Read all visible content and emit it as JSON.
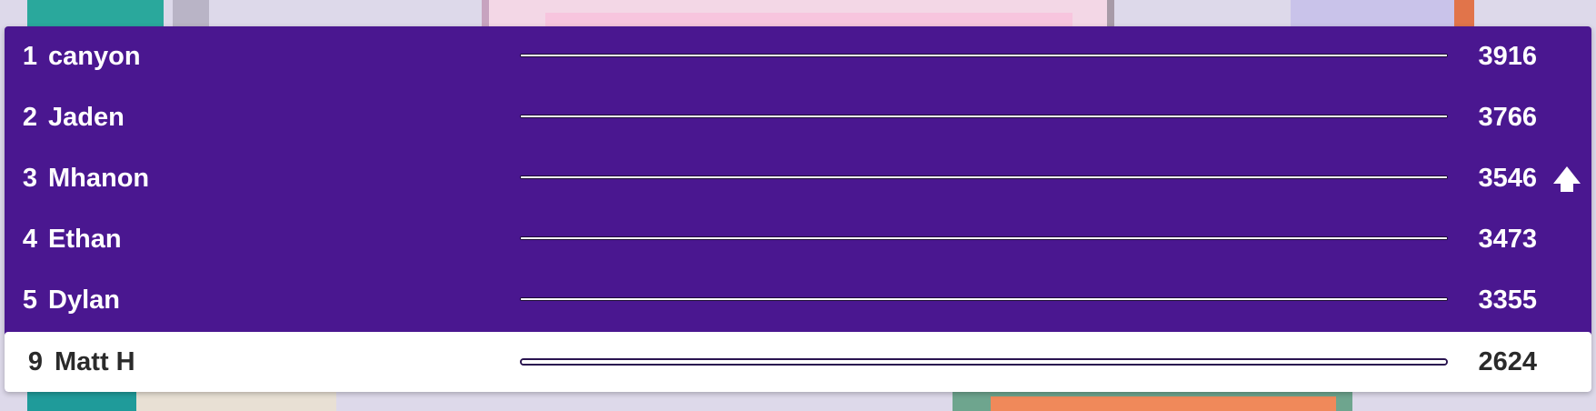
{
  "leaderboard": {
    "rows": [
      {
        "rank": "1",
        "name": "canyon",
        "score": "3916",
        "progress": 1.0
      },
      {
        "rank": "2",
        "name": "Jaden",
        "score": "3766",
        "progress": 1.0
      },
      {
        "rank": "3",
        "name": "Mhanon",
        "score": "3546",
        "progress": 1.0,
        "indicator": "up-arrow-icon"
      },
      {
        "rank": "4",
        "name": "Ethan",
        "score": "3473",
        "progress": 1.0
      },
      {
        "rank": "5",
        "name": "Dylan",
        "score": "3355",
        "progress": 1.0
      }
    ],
    "current_player": {
      "rank": "9",
      "name": "Matt H",
      "score": "2624",
      "progress": 1.0
    }
  },
  "colors": {
    "panel": "#4a1790",
    "current_row": "#ffffff",
    "text_light": "#ffffff",
    "text_dark": "#2a2a2a"
  }
}
